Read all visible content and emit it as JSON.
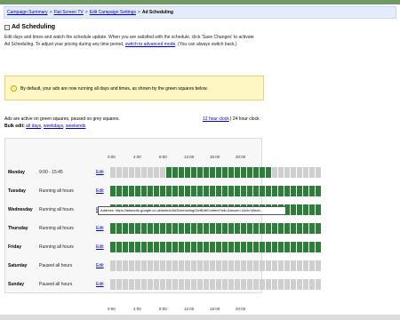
{
  "breadcrumb": {
    "items": [
      "Campaign Summary",
      "Flat Screen TV",
      "Edit Campaign Settings"
    ],
    "separator": ">",
    "current": "Ad Scheduling"
  },
  "page": {
    "expand_symbol": "-",
    "title": "Ad Scheduling",
    "description_before": "Edit days and times and watch the schedule update. When you are satisfied with the schedule, click 'Save Changes' to activate Ad Scheduling. To adjust your pricing during any time period, ",
    "description_link": "switch to advanced mode",
    "description_after": ". (You can always switch back.)"
  },
  "info": {
    "icon": "lightbulb-icon",
    "icon_glyph": "!",
    "text": "By default, your ads are now running all days and times, as shown by the green squares below."
  },
  "legend": {
    "text": "Ads are active on green squares, paused on grey squares.",
    "bulk_label": "Bulk edit:",
    "bulk_links": [
      "all days",
      "weekdays",
      "weekends"
    ],
    "clock_12": "12 hour clock",
    "clock_sep": "|",
    "clock_24": "24 hour clock"
  },
  "hour_labels": [
    "0:00",
    "4:00",
    "8:00",
    "12:00",
    "16:00",
    "20:00"
  ],
  "edit_label": "Edit",
  "days": [
    {
      "name": "Monday",
      "hours": "9:00 - 15:45",
      "cells": "000000000ooooooooooooooooo00000000"
    },
    {
      "name": "Tuesday",
      "hours": "Running all hours",
      "cells": "oooooooooooooooooooooooooooooooooo"
    },
    {
      "name": "Wednesday",
      "hours": "Running all hours",
      "cells": "oooooooooooooooooooooooooooooooooo"
    },
    {
      "name": "Thursday",
      "hours": "Running all hours",
      "cells": "oooooooooooooooooooooooooooooooooo"
    },
    {
      "name": "Friday",
      "hours": "Running all hours",
      "cells": "oooooooooooooooooooooooooooooooooo"
    },
    {
      "name": "Saturday",
      "hours": "Paused all hours",
      "cells": "0000000000000000000000000000000000"
    },
    {
      "name": "Sunday",
      "hours": "Paused all hours",
      "cells": "0000000000000000000000000000000000"
    }
  ],
  "tooltip": "Address: https://adwords.google.co.uk/select/AdScheduling/GetEditContent?wk=&mode=1&ck=Wedn...",
  "colors": {
    "active": "#2f7d3a",
    "paused": "#cfcfcf"
  }
}
